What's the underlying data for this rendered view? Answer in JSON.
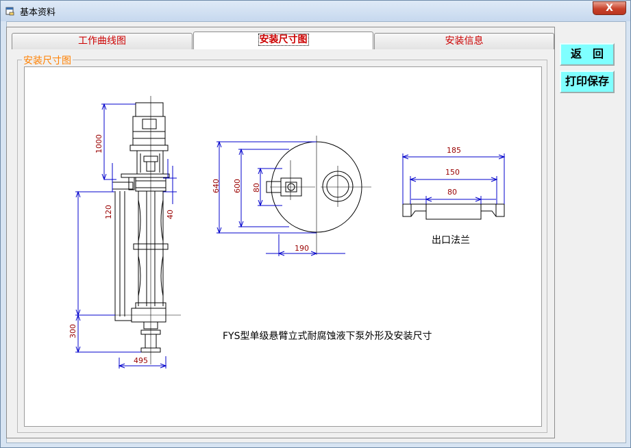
{
  "window": {
    "title": "基本资料",
    "close_label": "X"
  },
  "tabs": [
    {
      "label": "工作曲线图",
      "active": false
    },
    {
      "label": "安装尺寸图",
      "active": true
    },
    {
      "label": "安装信息",
      "active": false
    }
  ],
  "group": {
    "legend": "安装尺寸图"
  },
  "buttons": {
    "back": "返　回",
    "print_save": "打印保存"
  },
  "drawing": {
    "caption": "FYS型单级悬臂立式耐腐蚀液下泵外形及安装尺寸",
    "flange_label": "出口法兰",
    "pump_dims": {
      "d1000": "1000",
      "d120": "120",
      "d40": "40",
      "d300": "300",
      "d495": "495"
    },
    "plan_dims": {
      "d640": "640",
      "d600": "600",
      "d80": "80",
      "d190": "190"
    },
    "flange_dims": {
      "d185": "185",
      "d150": "150",
      "d80": "80"
    }
  },
  "colors": {
    "dimension_line": "#0000cc",
    "dimension_text": "#990000",
    "tab_text": "#cc0000",
    "legend_text": "#ff8000",
    "button_bg": "#7fffff"
  }
}
